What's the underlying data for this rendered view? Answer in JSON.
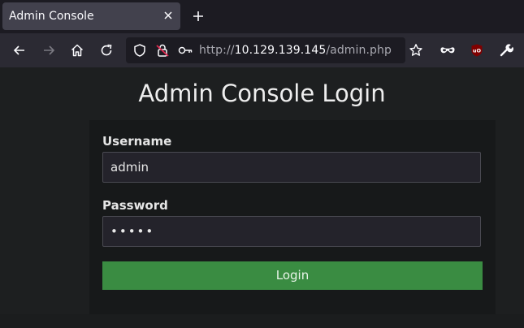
{
  "browser": {
    "tab": {
      "title": "Admin Console",
      "close_icon": "close-icon"
    },
    "new_tab_icon": "plus-icon",
    "toolbar": {
      "url_prefix": "http://",
      "url_host": "10.129.139.145",
      "url_path": "/admin.php"
    }
  },
  "page": {
    "title": "Admin Console Login",
    "form": {
      "username_label": "Username",
      "username_value": "admin",
      "password_label": "Password",
      "password_value": "•••••",
      "login_label": "Login"
    }
  },
  "colors": {
    "accent_button": "#3a8c42",
    "page_bg": "#1d1f20",
    "card_bg": "#17191a"
  }
}
